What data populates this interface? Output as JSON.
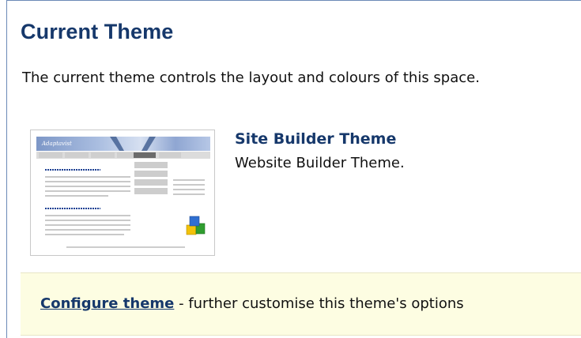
{
  "header": {
    "title": "Current Theme"
  },
  "description": "The current theme controls the layout and colours of this space.",
  "theme": {
    "thumbnail_banner_text": "Adaptavist",
    "name": "Site Builder Theme",
    "description": "Website Builder Theme."
  },
  "configure": {
    "link_label": "Configure theme",
    "trailing_text": " - further customise this theme's options"
  },
  "colors": {
    "heading": "#16386b",
    "frame_border": "#6b8ab7",
    "config_background": "#fdfde2"
  }
}
